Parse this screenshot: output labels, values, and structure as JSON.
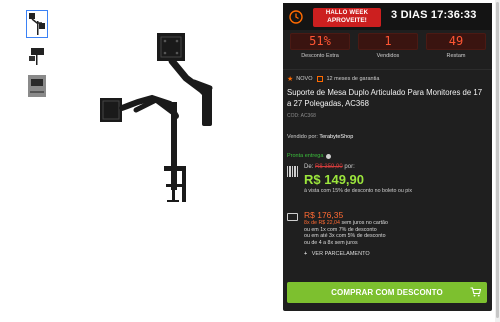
{
  "promo": {
    "badge_line1": "HALLO WEEK",
    "badge_line2": "APROVEITE!",
    "countdown": "3 DIAS 17:36:33"
  },
  "stats": [
    {
      "value": "51%",
      "label": "Desconto Extra"
    },
    {
      "value": "1",
      "label": "Vendidos"
    },
    {
      "value": "49",
      "label": "Restam"
    }
  ],
  "product": {
    "tag_new": "NOVO",
    "warranty": "12 meses de garantia",
    "title": "Suporte de Mesa Duplo Articulado Para Monitores de 17 a 27 Polegadas, AC368",
    "code": "COD: AC368",
    "seller_label": "Vendido por:",
    "seller_name": "TerabyteShop",
    "stock": "Pronta entrega"
  },
  "price": {
    "from_prefix": "De:",
    "old_price": "R$ 359,90",
    "from_suffix": "por:",
    "price": "R$ 149,90",
    "cash_note": "à vista com 15% de desconto no boleto ou pix"
  },
  "card": {
    "price": "R$ 176,35",
    "installment_pre": "8x de",
    "installment_value": "R$ 22,04",
    "installment_post": "sem juros no cartão",
    "line2": "ou em 1x com 7% de desconto",
    "line3": "ou em até 3x com 5% de desconto",
    "line4": "ou de 4 a 8x sem juros",
    "more": "VER PARCELAMENTO"
  },
  "buy_button": "COMPRAR COM DESCONTO",
  "colors": {
    "panel": "#1f1f1f",
    "accent_red": "#cc1f1f",
    "price_green": "#9be53c",
    "button_green": "#7dc02f",
    "orange": "#ff6a33"
  }
}
